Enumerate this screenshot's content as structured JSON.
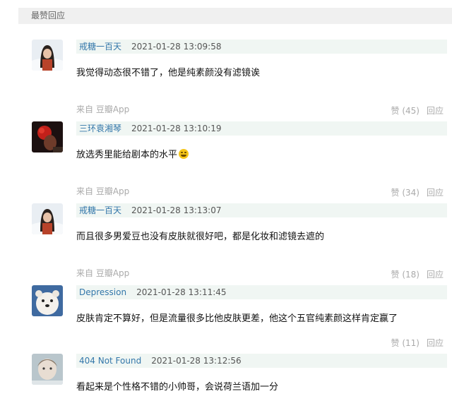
{
  "section": {
    "title": "最赞回应"
  },
  "comments": [
    {
      "author": "戒糖一百天",
      "time": "2021-01-28 13:09:58",
      "text": "我觉得动态很不错了，他是纯素颜没有滤镜诶",
      "source": "来自 豆瓣App",
      "like_label": "赞 (45)",
      "reply_label": "回应",
      "avatar": "avatar-girl-snow"
    },
    {
      "author": "三环袁湘琴",
      "time": "2021-01-28 13:10:19",
      "text": "放选秀里能给剧本的水平",
      "has_emoji": true,
      "emoji": "laughing-face-emoji",
      "source": "来自 豆瓣App",
      "like_label": "赞 (34)",
      "reply_label": "回应",
      "avatar": "avatar-dark-flower"
    },
    {
      "author": "戒糖一百天",
      "time": "2021-01-28 13:13:07",
      "text": "而且很多男爱豆也没有皮肤就很好吧，都是化妆和滤镜去遮的",
      "source": "来自 豆瓣App",
      "like_label": "赞 (18)",
      "reply_label": "回应",
      "avatar": "avatar-girl-snow"
    },
    {
      "author": "Depression",
      "time": "2021-01-28 13:11:45",
      "text": "皮肤肯定不算好，但是流量很多比他皮肤更差，他这个五官纯素颜这样肯定赢了",
      "like_label": "赞 (11)",
      "reply_label": "回应",
      "avatar": "avatar-white-dog"
    },
    {
      "author": "404 Not Found",
      "time": "2021-01-28 13:12:56",
      "text": "看起来是个性格不错的小帅哥，会说荷兰语加一分",
      "avatar": "avatar-child"
    }
  ]
}
